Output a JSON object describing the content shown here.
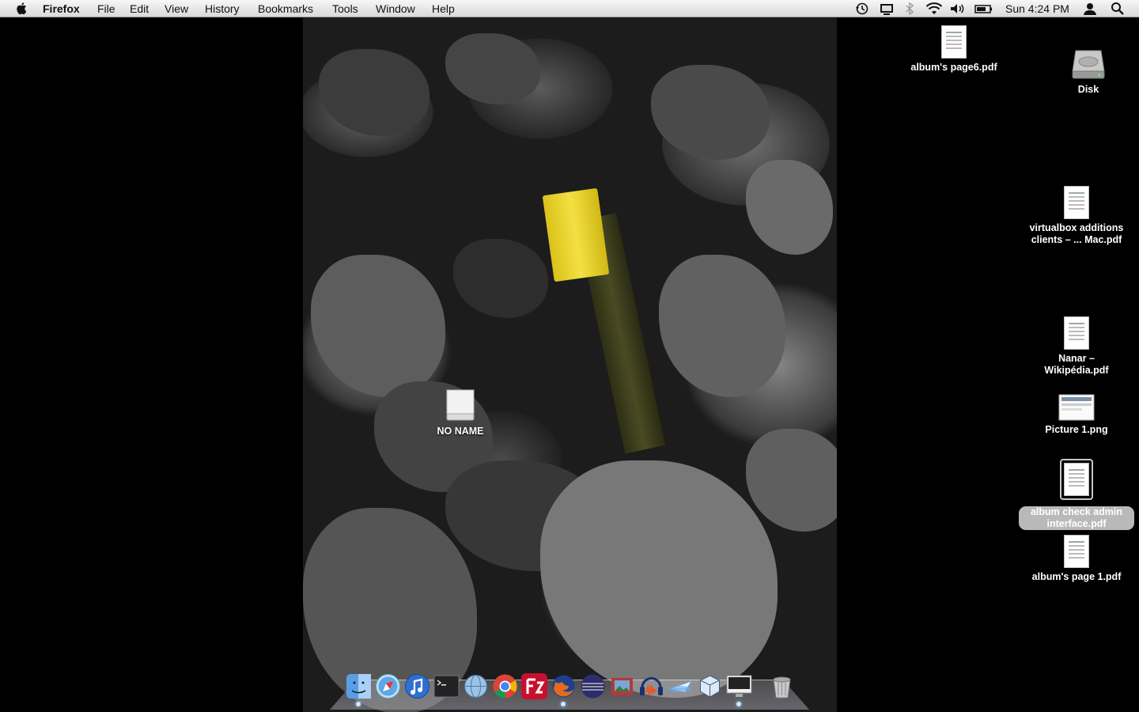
{
  "menubar": {
    "app_name": "Firefox",
    "items": [
      "File",
      "Edit",
      "View",
      "History",
      "Bookmarks",
      "Tools",
      "Window",
      "Help"
    ],
    "clock": "Sun 4:24 PM",
    "status_icons": [
      "time-machine-icon",
      "display-icon",
      "bluetooth-icon",
      "wifi-icon",
      "volume-icon",
      "battery-icon",
      "user-icon",
      "spotlight-icon"
    ]
  },
  "desktop": {
    "icons": [
      {
        "label": "album's page6.pdf",
        "kind": "pdf"
      },
      {
        "label": "Disk",
        "kind": "hard-drive"
      },
      {
        "label": "virtualbox additions clients – ... Mac.pdf",
        "kind": "pdf"
      },
      {
        "label": "Nanar – Wikipédia.pdf",
        "kind": "pdf"
      },
      {
        "label": "Picture 1.png",
        "kind": "png"
      },
      {
        "label": "album check admin interface.pdf",
        "kind": "pdf",
        "selected": true
      },
      {
        "label": "album's page 1.pdf",
        "kind": "pdf"
      },
      {
        "label": "NO NAME",
        "kind": "removable-drive"
      }
    ]
  },
  "dock": {
    "apps": [
      {
        "name": "Finder",
        "color": "#4a8fd8",
        "running": true
      },
      {
        "name": "Safari",
        "color": "#5da7e6",
        "running": false
      },
      {
        "name": "iTunes",
        "color": "#2f6fd0",
        "running": false
      },
      {
        "name": "Terminal",
        "color": "#222222",
        "running": false
      },
      {
        "name": "Network Utility",
        "color": "#6b9fce",
        "running": false
      },
      {
        "name": "Google Chrome",
        "color": "#e8e8e8",
        "running": false
      },
      {
        "name": "FileZilla",
        "color": "#c8102e",
        "running": false
      },
      {
        "name": "Firefox",
        "color": "#e66a1c",
        "running": true
      },
      {
        "name": "Eclipse",
        "color": "#2c2c6e",
        "running": false
      },
      {
        "name": "Photo Booth",
        "color": "#b33a3a",
        "running": false
      },
      {
        "name": "Audacity",
        "color": "#f2a21c",
        "running": false
      },
      {
        "name": "Mail",
        "color": "#69a9e3",
        "running": false
      },
      {
        "name": "VirtualBox",
        "color": "#8ba8c8",
        "running": false
      },
      {
        "name": "Screen Sharing",
        "color": "#333333",
        "running": true
      },
      {
        "name": "Trash",
        "color": "#9a9a9a",
        "running": false
      }
    ]
  }
}
